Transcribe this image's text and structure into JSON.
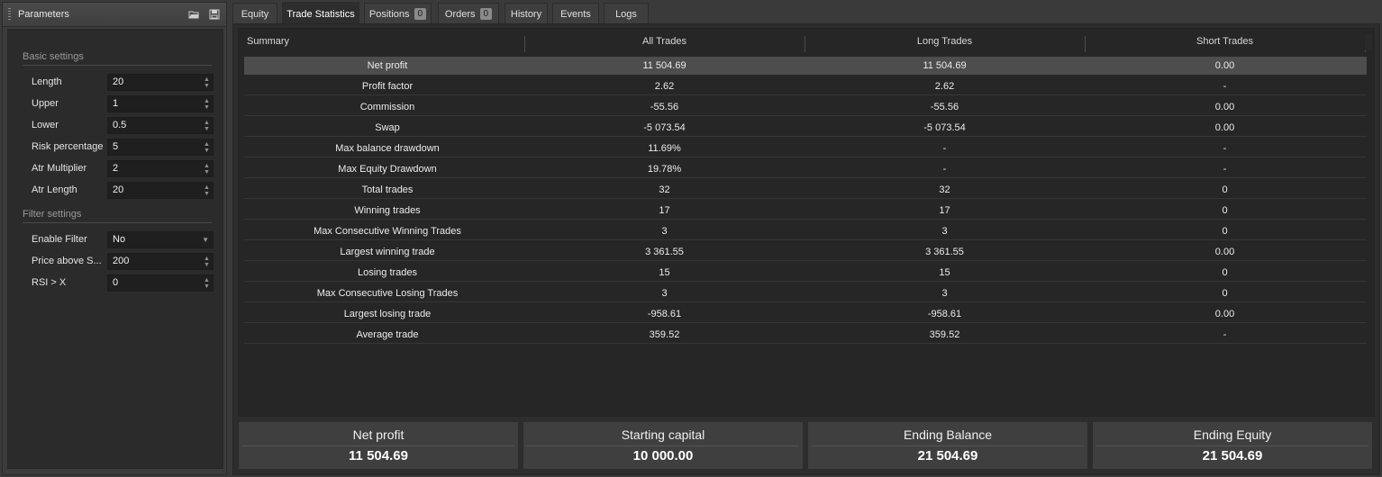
{
  "parameters": {
    "title": "Parameters",
    "sections": [
      {
        "label": "Basic settings",
        "fields": [
          {
            "label": "Length",
            "value": "20",
            "type": "stepper"
          },
          {
            "label": "Upper",
            "value": "1",
            "type": "stepper"
          },
          {
            "label": "Lower",
            "value": "0.5",
            "type": "stepper"
          },
          {
            "label": "Risk percentage",
            "value": "5",
            "type": "stepper"
          },
          {
            "label": "Atr Multiplier",
            "value": "2",
            "type": "stepper"
          },
          {
            "label": "Atr Length",
            "value": "20",
            "type": "stepper"
          }
        ]
      },
      {
        "label": "Filter settings",
        "fields": [
          {
            "label": "Enable Filter",
            "value": "No",
            "type": "dropdown"
          },
          {
            "label": "Price above S...",
            "value": "200",
            "type": "stepper"
          },
          {
            "label": "RSI > X",
            "value": "0",
            "type": "stepper"
          }
        ]
      }
    ]
  },
  "tabs": [
    {
      "label": "Equity"
    },
    {
      "label": "Trade Statistics",
      "active": true
    },
    {
      "label": "Positions",
      "count": "0"
    },
    {
      "label": "Orders",
      "count": "0"
    },
    {
      "label": "History"
    },
    {
      "label": "Events"
    },
    {
      "label": "Logs"
    }
  ],
  "stats_table": {
    "headers": [
      "Summary",
      "All Trades",
      "Long Trades",
      "Short Trades"
    ],
    "rows": [
      [
        "Net profit",
        "11 504.69",
        "11 504.69",
        "0.00"
      ],
      [
        "Profit factor",
        "2.62",
        "2.62",
        "-"
      ],
      [
        "Commission",
        "-55.56",
        "-55.56",
        "0.00"
      ],
      [
        "Swap",
        "-5 073.54",
        "-5 073.54",
        "0.00"
      ],
      [
        "Max balance drawdown",
        "11.69%",
        "-",
        "-"
      ],
      [
        "Max Equity Drawdown",
        "19.78%",
        "-",
        "-"
      ],
      [
        "Total trades",
        "32",
        "32",
        "0"
      ],
      [
        "Winning trades",
        "17",
        "17",
        "0"
      ],
      [
        "Max Consecutive Winning Trades",
        "3",
        "3",
        "0"
      ],
      [
        "Largest winning trade",
        "3 361.55",
        "3 361.55",
        "0.00"
      ],
      [
        "Losing trades",
        "15",
        "15",
        "0"
      ],
      [
        "Max Consecutive Losing Trades",
        "3",
        "3",
        "0"
      ],
      [
        "Largest losing trade",
        "-958.61",
        "-958.61",
        "0.00"
      ],
      [
        "Average trade",
        "359.52",
        "359.52",
        "-"
      ]
    ]
  },
  "summary_cards": [
    {
      "label": "Net profit",
      "value": "11 504.69"
    },
    {
      "label": "Starting capital",
      "value": "10 000.00"
    },
    {
      "label": "Ending Balance",
      "value": "21 504.69"
    },
    {
      "label": "Ending Equity",
      "value": "21 504.69"
    }
  ]
}
